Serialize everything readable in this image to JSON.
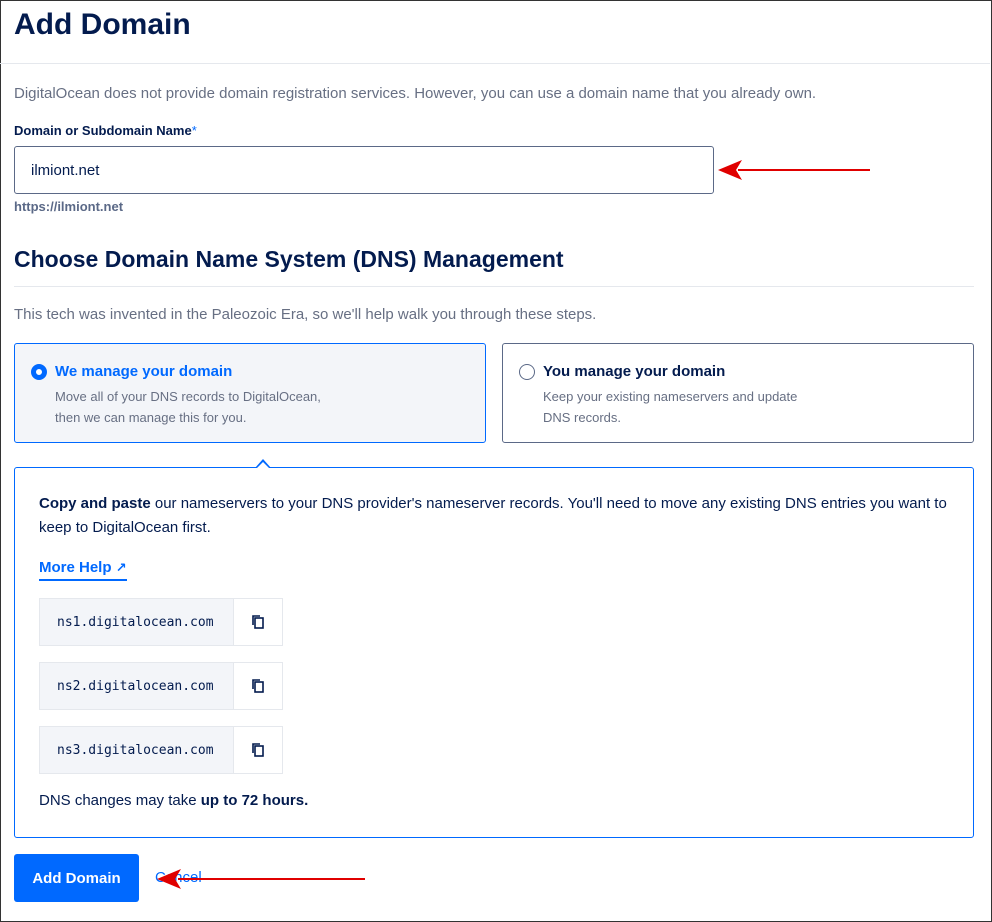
{
  "page": {
    "title": "Add Domain",
    "intro": "DigitalOcean does not provide domain registration services. However, you can use a domain name that you already own."
  },
  "domain_field": {
    "label": "Domain or Subdomain Name",
    "required_mark": "*",
    "value": "ilmiont.net",
    "url_preview": "https://ilmiont.net"
  },
  "dns_section": {
    "title": "Choose Domain Name System (DNS) Management",
    "subtitle": "This tech was invented in the Paleozoic Era, so we'll help walk you through these steps.",
    "options": [
      {
        "title": "We manage your domain",
        "desc_line1": "Move all of your DNS records to DigitalOcean,",
        "desc_line2": "then we can manage this for you.",
        "selected": true
      },
      {
        "title": "You manage your domain",
        "desc_line1": "Keep your existing nameservers and update",
        "desc_line2": "DNS records.",
        "selected": false
      }
    ]
  },
  "panel": {
    "intro_bold": "Copy and paste",
    "intro_rest": " our nameservers to your DNS provider's nameserver records. You'll need to move any existing DNS entries you want to keep to DigitalOcean first.",
    "more_help": "More Help",
    "more_help_icon": "↗",
    "nameservers": [
      "ns1.digitalocean.com",
      "ns2.digitalocean.com",
      "ns3.digitalocean.com"
    ],
    "note_prefix": "DNS changes may take ",
    "note_bold": "up to 72 hours."
  },
  "actions": {
    "add_label": "Add Domain",
    "cancel_label": "Cancel"
  },
  "colors": {
    "accent": "#0069ff",
    "heading": "#031b4e",
    "annotation_arrow": "#e00000"
  },
  "icons": [
    "copy-icon",
    "external-link-icon",
    "annotation-arrow"
  ]
}
